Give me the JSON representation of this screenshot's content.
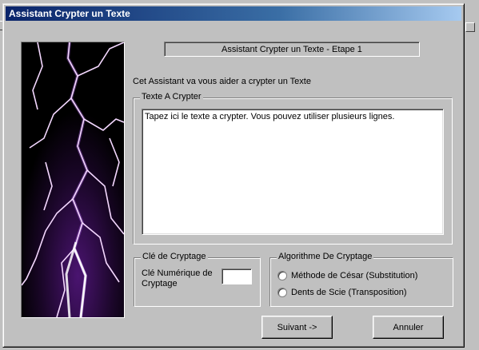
{
  "window": {
    "title": "Assistant Crypter un Texte"
  },
  "step_title": "Assistant Crypter un Texte - Etape 1",
  "intro": "Cet Assistant va vous aider a crypter un Texte",
  "text_group": {
    "legend": "Texte A Crypter",
    "value": "Tapez ici le texte a crypter. Vous pouvez utiliser plusieurs lignes."
  },
  "key_group": {
    "legend": "Clé de Cryptage",
    "label": "Clé Numérique de Cryptage",
    "value": ""
  },
  "algo_group": {
    "legend": "Algorithme De Cryptage",
    "options": [
      "Méthode de César (Substitution)",
      "Dents de Scie (Transposition)"
    ]
  },
  "buttons": {
    "next": "Suivant ->",
    "cancel": "Annuler"
  },
  "colors": {
    "face": "#c0c0c0",
    "title_start": "#0a246a",
    "title_end": "#a6caf0",
    "lightning": "#d58cff"
  },
  "image": {
    "icon": "lightning-image"
  }
}
